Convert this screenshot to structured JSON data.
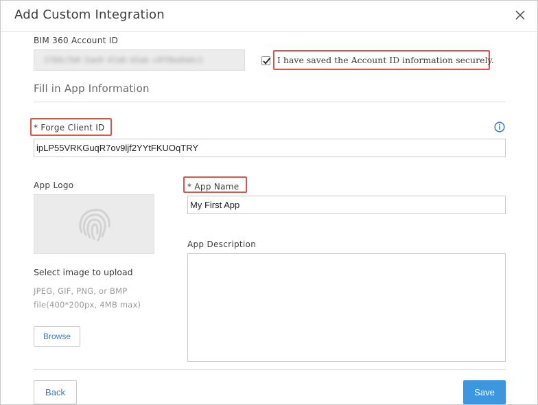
{
  "dialog": {
    "title": "Add Custom Integration",
    "close_icon": "close-icon"
  },
  "account": {
    "label": "BIM 360 Account ID",
    "value_blurred": "1f60c7b0-5ae9-47a0-b5ab-c0f9ba9a6c1",
    "saved_checkbox_checked": true,
    "saved_checkbox_label": "I have saved the Account ID information securely."
  },
  "app_info": {
    "section_title": "Fill in App Information",
    "client_id_label": "* Forge Client ID",
    "client_id_value": "ipLP55VRKGuqR7ov9ljf2YYtFKUOqTRY",
    "info_icon": "info-icon",
    "app_name_label": "* App Name",
    "app_name_value": "My First App",
    "app_description_label": "App Description",
    "app_description_value": ""
  },
  "logo": {
    "label": "App Logo",
    "placeholder_icon": "fingerprint-icon",
    "upload_title": "Select image to upload",
    "upload_help": "JPEG, GIF, PNG, or BMP file(400*200px, 4MB max)",
    "browse_label": "Browse"
  },
  "footer": {
    "back_label": "Back",
    "save_label": "Save"
  },
  "colors": {
    "highlight": "#d9534f",
    "primary": "#3d97df",
    "link": "#3a79c4"
  }
}
